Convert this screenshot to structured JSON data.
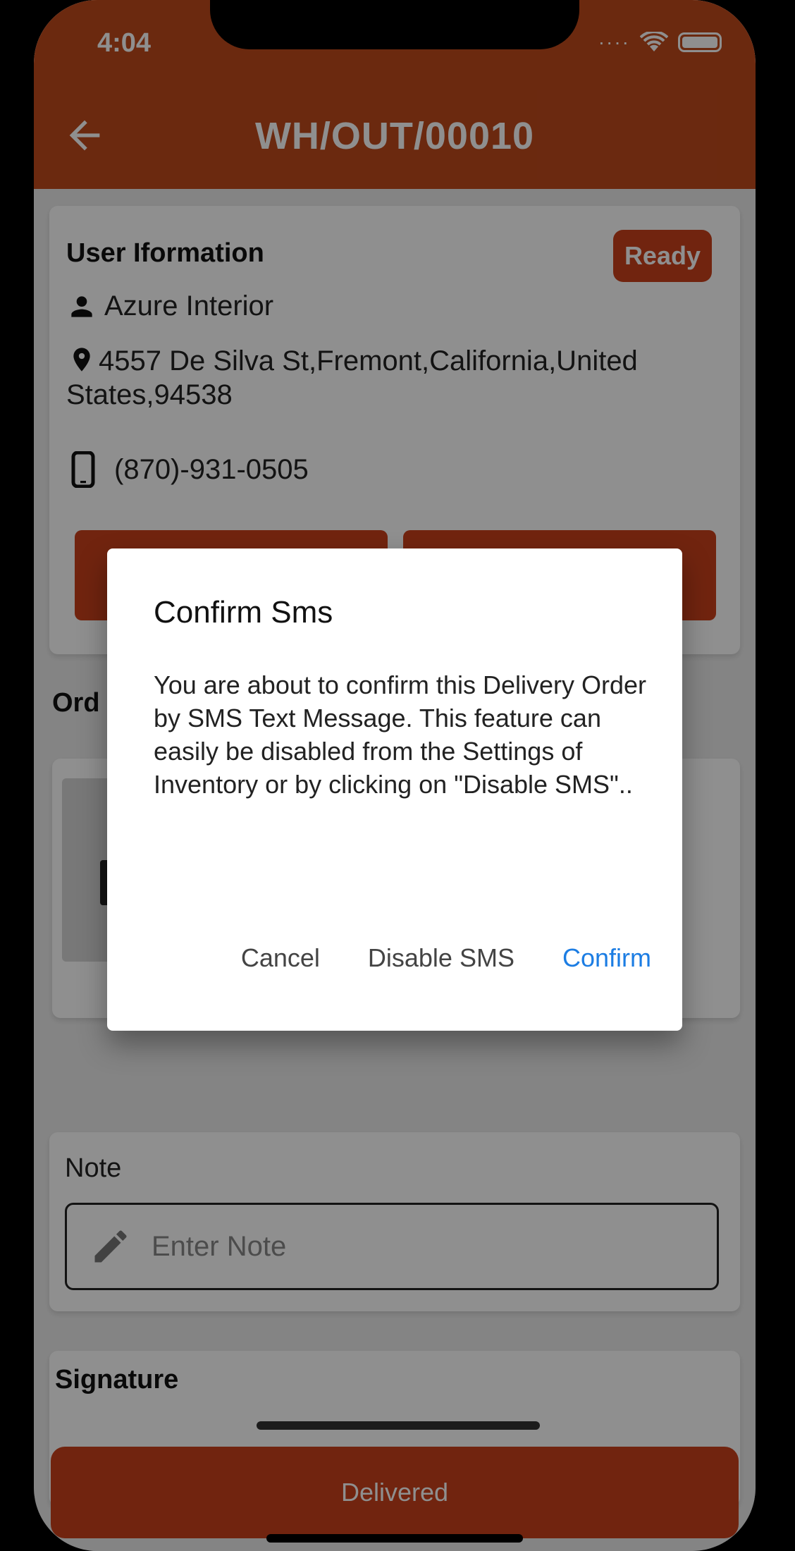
{
  "status_bar": {
    "time": "4:04"
  },
  "app_bar": {
    "title": "WH/OUT/00010"
  },
  "user_info": {
    "heading": "User Iformation",
    "status_badge": "Ready",
    "name": "Azure Interior",
    "address": "4557 De Silva St,Fremont,California,United States,94538",
    "phone": "(870)-931-0505"
  },
  "orders": {
    "heading": "Ord",
    "product_name_partial": "k"
  },
  "note": {
    "label": "Note",
    "placeholder": "Enter Note"
  },
  "signature": {
    "heading": "Signature"
  },
  "bottom_button": {
    "label": "Delivered"
  },
  "dialog": {
    "title": "Confirm Sms",
    "body": "You are about to confirm this Delivery Order by SMS Text Message. This feature can easily be disabled from the Settings of Inventory or by clicking on \"Disable SMS\"..",
    "cancel_label": "Cancel",
    "disable_label": "Disable SMS",
    "confirm_label": "Confirm"
  },
  "colors": {
    "brand": "#c9401b",
    "dialog_confirm": "#1c7de3"
  }
}
